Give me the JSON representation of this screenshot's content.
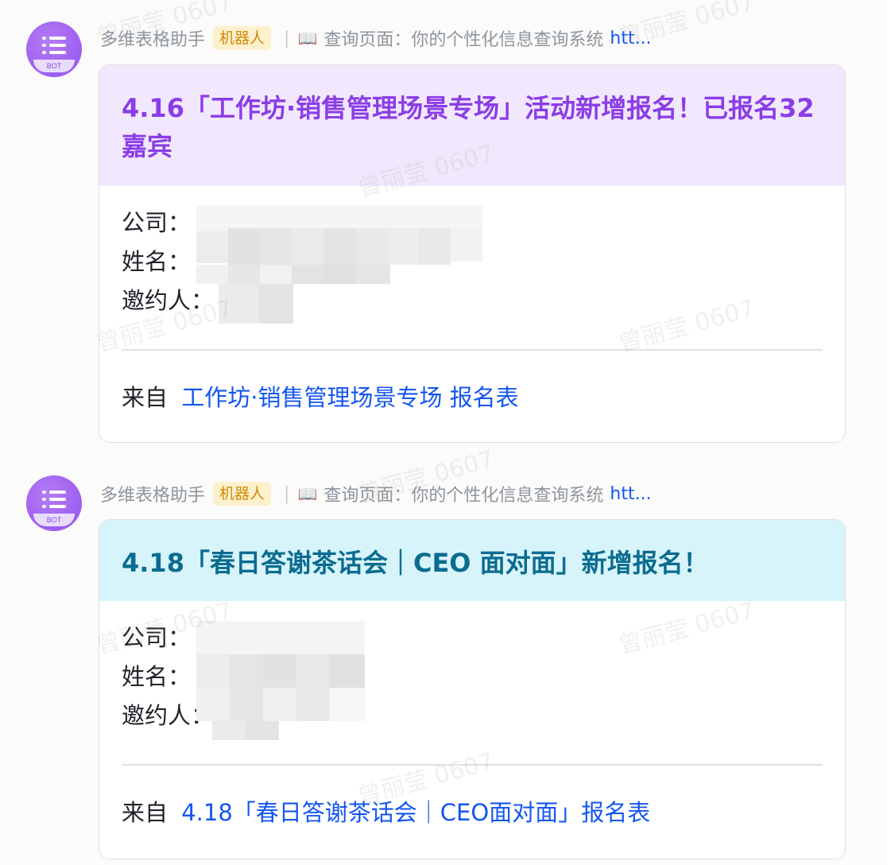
{
  "messages": [
    {
      "sender": "多维表格助手",
      "bot_badge": "机器人",
      "separator": "|",
      "query_label": "查询页面：你的个性化信息查询系统",
      "query_link": "htt...",
      "avatar_tag": "BOT",
      "card": {
        "theme": "purple",
        "title": "4.16「工作坊·销售管理场景专场」活动新增报名！已报名32嘉宾",
        "fields": [
          "公司：",
          "姓名：",
          "邀约人："
        ],
        "footer_prefix": "来自",
        "footer_link": "工作坊·销售管理场景专场 报名表"
      }
    },
    {
      "sender": "多维表格助手",
      "bot_badge": "机器人",
      "separator": "|",
      "query_label": "查询页面：你的个性化信息查询系统",
      "query_link": "htt...",
      "avatar_tag": "BOT",
      "card": {
        "theme": "cyan",
        "title": "4.18「春日答谢茶话会｜CEO 面对面」新增报名！",
        "fields": [
          "公司：",
          "姓名：",
          "邀约人："
        ],
        "footer_prefix": "来自",
        "footer_link": "4.18「春日答谢茶话会｜CEO面对面」报名表"
      }
    }
  ],
  "watermark_text": "曾丽莹 0607",
  "colors": {
    "avatar": "#9d5ef0",
    "badge_bg": "#fdf0cc",
    "badge_text": "#d18a08",
    "link": "#1456f0",
    "purple_header": "#f2e8fd",
    "purple_title": "#8a3de6",
    "cyan_header": "#d8f4fb",
    "cyan_title": "#0b6c8f"
  }
}
